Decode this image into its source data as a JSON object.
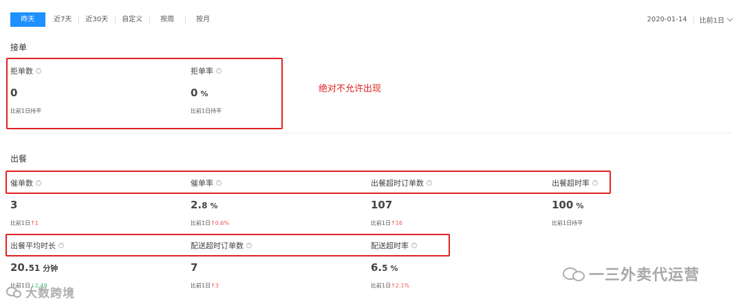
{
  "tabs": [
    "昨天",
    "近7天",
    "近30天",
    "自定义",
    "按周",
    "按月"
  ],
  "date": "2020-01-14",
  "compare_select": "比前1日",
  "sections": {
    "accept": {
      "title": "接单"
    },
    "meal": {
      "title": "出餐"
    }
  },
  "metrics": {
    "reject_count": {
      "label": "拒单数",
      "value": "0",
      "value_dec": "",
      "unit": "",
      "cmp_prefix": "比前1日持平",
      "cmp_arrow": "",
      "cmp_value": "",
      "cmp_dir": ""
    },
    "reject_rate": {
      "label": "拒单率",
      "value": "0",
      "value_dec": "",
      "unit": "%",
      "cmp_prefix": "比前1日持平",
      "cmp_arrow": "",
      "cmp_value": "",
      "cmp_dir": ""
    },
    "urge_count": {
      "label": "催单数",
      "value": "3",
      "value_dec": "",
      "unit": "",
      "cmp_prefix": "比前1日",
      "cmp_arrow": "↑",
      "cmp_value": "1",
      "cmp_dir": "up"
    },
    "urge_rate": {
      "label": "催单率",
      "value": "2.",
      "value_dec": "8",
      "unit": "%",
      "cmp_prefix": "比前1日",
      "cmp_arrow": "↑",
      "cmp_value": "0.6%",
      "cmp_dir": "up"
    },
    "timeout_orders": {
      "label": "出餐超时订单数",
      "value": "107",
      "value_dec": "",
      "unit": "",
      "cmp_prefix": "比前1日",
      "cmp_arrow": "↑",
      "cmp_value": "16",
      "cmp_dir": "up"
    },
    "timeout_rate": {
      "label": "出餐超时率",
      "value": "100",
      "value_dec": "",
      "unit": "%",
      "cmp_prefix": "比前1日持平",
      "cmp_arrow": "",
      "cmp_value": "",
      "cmp_dir": ""
    },
    "avg_time": {
      "label": "出餐平均时长",
      "value": "20.",
      "value_dec": "51",
      "unit": "分钟",
      "cmp_prefix": "比前1日",
      "cmp_arrow": "↓",
      "cmp_value": "2.49",
      "cmp_dir": "down"
    },
    "delivery_timeout_orders": {
      "label": "配送超时订单数",
      "value": "7",
      "value_dec": "",
      "unit": "",
      "cmp_prefix": "比前1日",
      "cmp_arrow": "↑",
      "cmp_value": "3",
      "cmp_dir": "up"
    },
    "delivery_timeout_rate": {
      "label": "配送超时率",
      "value": "6.",
      "value_dec": "5",
      "unit": "%",
      "cmp_prefix": "比前1日",
      "cmp_arrow": "↑",
      "cmp_value": "2.1%",
      "cmp_dir": "up"
    }
  },
  "annotation": "绝对不允许出现",
  "watermarks": {
    "right": "一三外卖代运营",
    "left": "大数跨境"
  },
  "colors": {
    "accent": "#1e90ff",
    "up": "#f05050",
    "down": "#3cb371",
    "highlight": "#e02020"
  }
}
